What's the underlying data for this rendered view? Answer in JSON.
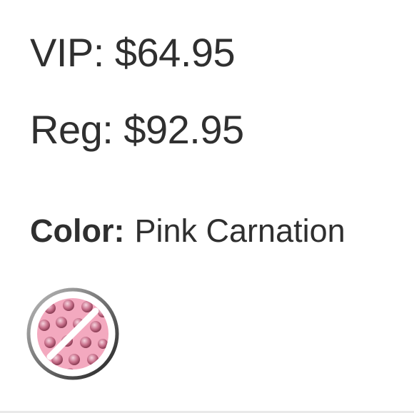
{
  "pricing": {
    "vip_label": "VIP:",
    "vip_price": "$64.95",
    "reg_label": "Reg:",
    "reg_price": "$92.95"
  },
  "color": {
    "label": "Color:",
    "selected": "Pink Carnation",
    "swatch_state": "unavailable",
    "swatch_colors": [
      "#f2a6bd",
      "#a34d67"
    ],
    "swatch_icon": "crossed-out-swatch-icon"
  }
}
